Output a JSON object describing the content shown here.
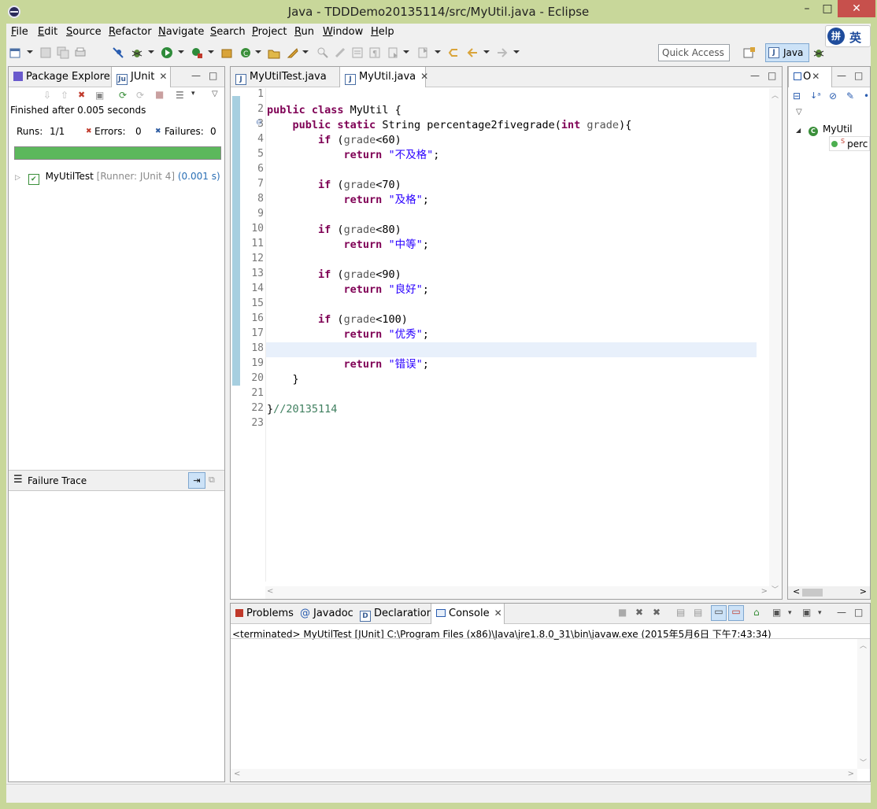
{
  "window": {
    "title": "Java - TDDDemo20135114/src/MyUtil.java - Eclipse"
  },
  "menu": [
    "File",
    "Edit",
    "Source",
    "Refactor",
    "Navigate",
    "Search",
    "Project",
    "Run",
    "Window",
    "Help"
  ],
  "toolbar": {
    "quick_access": "Quick Access",
    "perspective": "Java"
  },
  "ime": {
    "label": "英"
  },
  "left_pane": {
    "tabs": [
      "Package Explorer",
      "JUnit"
    ],
    "finished": "Finished after 0.005 seconds",
    "runs_label": "Runs:",
    "runs_value": "1/1",
    "errors_label": "Errors:",
    "errors_value": "0",
    "failures_label": "Failures:",
    "failures_value": "0",
    "tree_name": "MyUtilTest",
    "tree_meta": "[Runner: JUnit 4]",
    "tree_time": "(0.001 s)",
    "failure_trace": "Failure Trace"
  },
  "editor": {
    "tabs": [
      "MyUtilTest.java",
      "MyUtil.java"
    ],
    "line_numbers": [
      "1",
      "2",
      "3",
      "4",
      "5",
      "6",
      "7",
      "8",
      "9",
      "10",
      "11",
      "12",
      "13",
      "14",
      "15",
      "16",
      "17",
      "18",
      "19",
      "20",
      "21",
      "22",
      "23"
    ],
    "code": {
      "l2_kw": "public class",
      "l2_rest": " MyUtil {",
      "l3_kw": "public static",
      "l3_rest": " String percentage2fivegrade(",
      "l3_kw2": "int",
      "l3_var": " grade",
      "l3_end": "){",
      "if": "if",
      "return": "return",
      "grade": "grade",
      "c1": "<60)",
      "s1": "\"不及格\"",
      "c2": "<70)",
      "s2": "\"及格\"",
      "c3": "<80)",
      "s3": "\"中等\"",
      "c4": "<90)",
      "s4": "\"良好\"",
      "c5": "<100)",
      "s5": "\"优秀\"",
      "s6": "\"错误\"",
      "semicolon": ";",
      "l20": "}",
      "l22_brace": "}",
      "l22_comment": "//20135114"
    }
  },
  "outline": {
    "tab": "O",
    "class_name": "MyUtil",
    "method": "perc"
  },
  "bottom": {
    "tabs": [
      "Problems",
      "Javadoc",
      "Declaration",
      "Console"
    ],
    "console_line": "<terminated> MyUtilTest [JUnit] C:\\Program Files (x86)\\Java\\jre1.8.0_31\\bin\\javaw.exe (2015年5月6日 下午7:43:34)"
  },
  "colors": {
    "progress": "#5cb85c",
    "keyword": "#7f0055",
    "string": "#2a00ff",
    "comment": "#3f7f5f",
    "frame": "#c8d79a"
  }
}
